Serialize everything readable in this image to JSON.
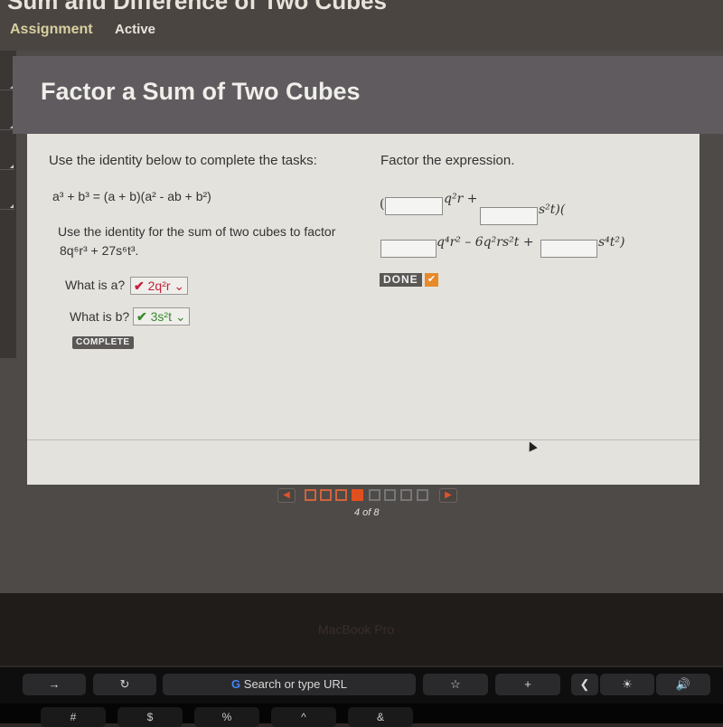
{
  "header": {
    "app_title": "Sum and Difference of Two Cubes",
    "tabs": [
      {
        "label": "Assignment"
      },
      {
        "label": "Active"
      }
    ]
  },
  "page_title": "Factor a Sum of Two Cubes",
  "left_panel": {
    "instruction": "Use the identity below to complete the tasks:",
    "identity": "a³ + b³ = (a + b)(a² - ab + b²)",
    "task_line1": "Use the identity for the sum of two cubes to factor",
    "task_line2": "8q⁶r³ + 27s⁶t³.",
    "question_a": {
      "label": "What is a?",
      "value": "2q²r",
      "check": "✔",
      "status": "incorrect"
    },
    "question_b": {
      "label": "What is b?",
      "value": "3s²t",
      "check": "✔",
      "status": "correct"
    },
    "complete_badge": "COMPLETE"
  },
  "right_panel": {
    "instruction": "Factor the expression.",
    "inputs": [
      {
        "value": "",
        "suffix": "q²r +"
      },
      {
        "value": "",
        "suffix": "s²t)("
      },
      {
        "value": "",
        "suffix": "q⁴r² – 6q²rs²t +"
      },
      {
        "value": "",
        "suffix": "s⁴t²)"
      }
    ],
    "open_paren": "(",
    "done_label": "DONE",
    "done_check": "✔"
  },
  "pager": {
    "prev": "◀",
    "next": "▶",
    "total": 8,
    "current": 4,
    "label": "4 of 8"
  },
  "bezel_brand": "MacBook Pro",
  "touchbar": {
    "back": "→",
    "reload": "↻",
    "search_placeholder": "Search or type URL",
    "google_glyph": "G",
    "bookmark": "☆",
    "new_tab": "+",
    "collapse": "❮",
    "brightness": "☀",
    "volume": "🔊"
  },
  "keyboard": [
    "#",
    "$",
    "%",
    "^",
    "&"
  ],
  "colors": {
    "accent": "#e0501e",
    "correct": "#3a8a2e",
    "incorrect": "#c2223a"
  }
}
